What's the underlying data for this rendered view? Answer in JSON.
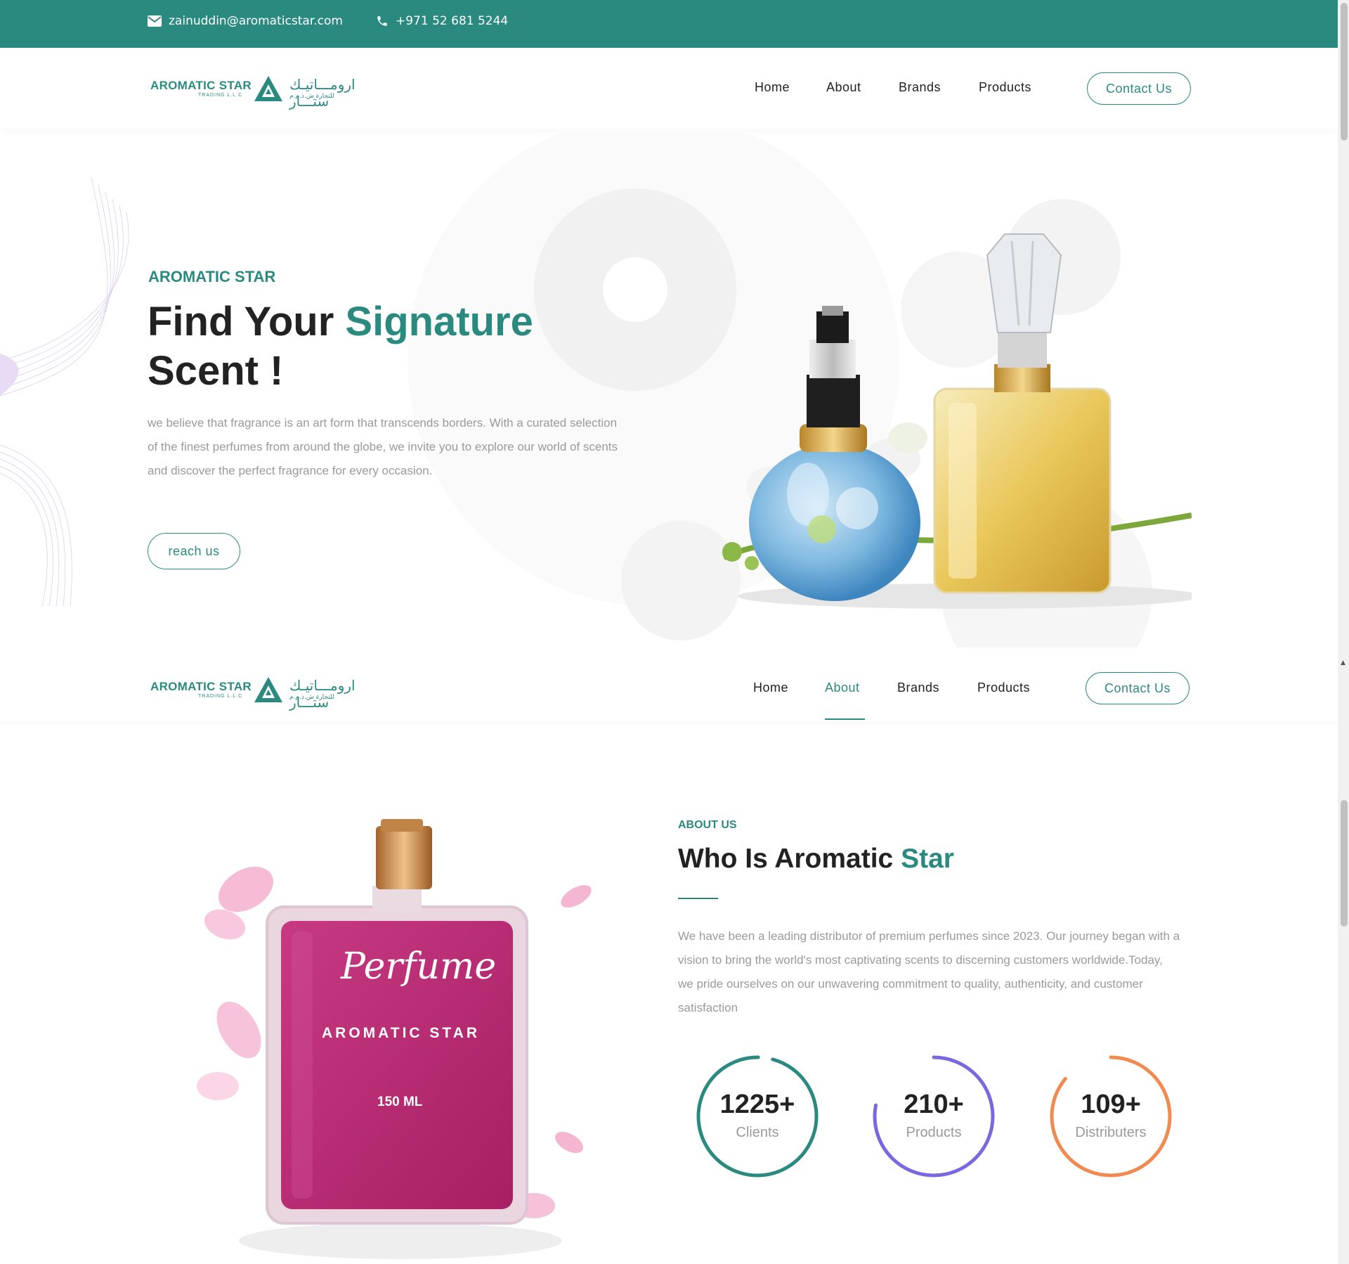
{
  "topbar": {
    "email": "zainuddin@aromaticstar.com",
    "phone": "+971 52 681 5244",
    "email_icon": "envelope-icon",
    "phone_icon": "phone-icon"
  },
  "logo": {
    "name_en": "AROMATIC STAR",
    "sub_en": "TRADING L.L.C",
    "name_ar": "ارومـــاتيـك ستـــار",
    "sub_ar": "للتجارة ش.ذ.م.م"
  },
  "nav": {
    "items": [
      {
        "label": "Home"
      },
      {
        "label": "About"
      },
      {
        "label": "Brands"
      },
      {
        "label": "Products"
      }
    ],
    "contact_label": "Contact Us",
    "active_sticky": "About"
  },
  "hero": {
    "eyebrow": "AROMATIC STAR",
    "title_part1": "Find Your ",
    "title_accent": "Signature",
    "title_part2": "Scent !",
    "description": "we believe that fragrance is an art form that transcends borders. With a curated selection of the finest perfumes from around the globe, we invite you to explore our world of scents and discover the perfect fragrance for every occasion.",
    "cta": "reach us"
  },
  "about": {
    "eyebrow": "ABOUT US",
    "title_part1": "Who Is Aromatic ",
    "title_accent": "Star",
    "description": "We have been a leading distributor of premium perfumes since 2023. Our journey began with a vision to bring the world's most captivating scents to discerning customers worldwide.Today, we pride ourselves on our unwavering commitment to quality, authenticity, and customer satisfaction",
    "bottle": {
      "script": "Perfume",
      "brand": "AROMATIC STAR",
      "volume": "150 ML"
    },
    "stats": [
      {
        "value": "1225+",
        "label": "Clients",
        "color": "#2b8a80",
        "progress": 0.96
      },
      {
        "value": "210+",
        "label": "Products",
        "color": "#7b68e0",
        "progress": 0.78
      },
      {
        "value": "109+",
        "label": "Distributers",
        "color": "#f08a50",
        "progress": 0.86
      }
    ]
  },
  "colors": {
    "brand": "#2b8a80",
    "text_dark": "#222222",
    "text_muted": "#9a9a9a"
  }
}
